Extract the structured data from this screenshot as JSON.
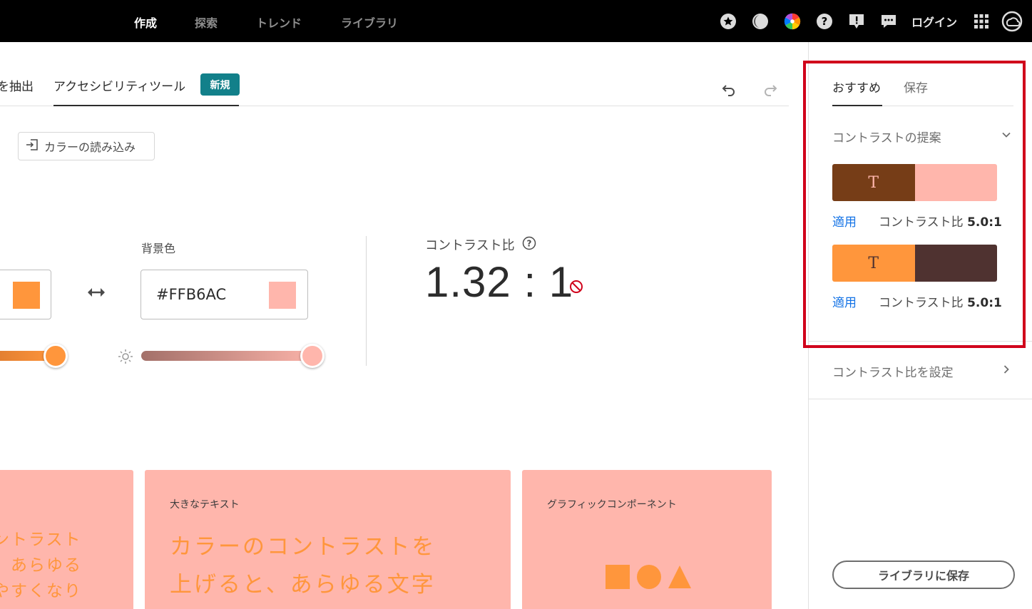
{
  "topnav": {
    "items": [
      "作成",
      "探索",
      "トレンド",
      "ライブラリ"
    ],
    "login_label": "ログイン",
    "icons": [
      "star-icon",
      "contrast-icon",
      "color-wheel-icon",
      "help-icon",
      "feedback-icon",
      "chat-icon",
      "apps-grid-icon",
      "creative-cloud-icon"
    ]
  },
  "tabs": {
    "extract_partial": "を抽出",
    "accessibility": "アクセシビリティツール",
    "new_badge": "新規"
  },
  "import_button": {
    "label": "カラーの読み込み",
    "icon": "import-icon"
  },
  "text_color": {
    "swatch": "#FF963C",
    "slider_gradient": [
      "#E07D30",
      "#FF963C"
    ]
  },
  "background_color": {
    "label": "背景色",
    "hex": "#FFB6AC",
    "swatch": "#FFB6AC",
    "slider_gradient": [
      "#A37069",
      "#FFB6AC"
    ]
  },
  "contrast": {
    "label": "コントラスト比",
    "value": "1.32 : 1",
    "status": "fail"
  },
  "preview_cards": {
    "small_text": {
      "lines": [
        "ントラスト",
        "、あらゆる",
        "やすくなり"
      ]
    },
    "large_text": {
      "title": "大きなテキスト",
      "lines": [
        "カラーのコントラストを",
        "上げると、あらゆる文字"
      ]
    },
    "graphic": {
      "title": "グラフィックコンポーネント"
    },
    "bg_color": "#FFB6AC",
    "fg_color": "#FF963C"
  },
  "right_panel": {
    "tabs": [
      "おすすめ",
      "保存"
    ],
    "section_title": "コントラストの提案",
    "suggestions": [
      {
        "glyph": "T",
        "left": "#763D17",
        "right": "#FFB6AC",
        "glyph_color": "#FFB6AC",
        "apply": "適用",
        "ratio_label": "コントラスト比",
        "ratio": "5.0:1"
      },
      {
        "glyph": "T",
        "left": "#FF963C",
        "right": "#4F3230",
        "glyph_color": "#4F3230",
        "apply": "適用",
        "ratio_label": "コントラスト比",
        "ratio": "5.0:1"
      }
    ],
    "set_ratio_label": "コントラスト比を設定",
    "save_library_label": "ライブラリに保存"
  },
  "colors": {
    "accent_badge": "#12808A",
    "link": "#1473E6",
    "highlight": "#D0021B"
  }
}
